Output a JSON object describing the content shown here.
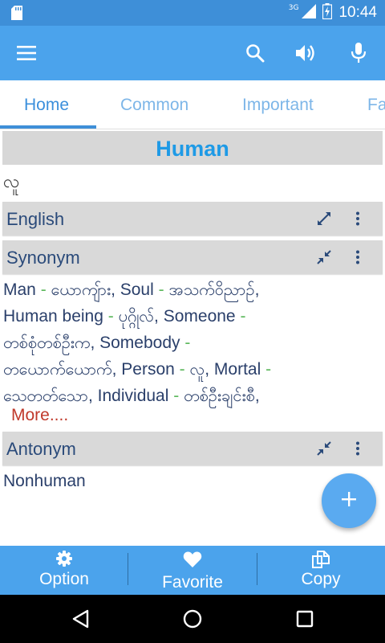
{
  "status_bar": {
    "network_type": "3G",
    "time": "10:44"
  },
  "toolbar": {
    "menu_icon": "hamburger-menu-icon",
    "search_icon": "search-icon",
    "speaker_icon": "speaker-icon",
    "mic_icon": "microphone-icon"
  },
  "tabs": [
    {
      "label": "Home",
      "active": true
    },
    {
      "label": "Common",
      "active": false
    },
    {
      "label": "Important",
      "active": false
    },
    {
      "label": "Fa",
      "active": false
    }
  ],
  "word": {
    "title": "Human",
    "translation": "လူ"
  },
  "sections": {
    "english": {
      "label": "English",
      "icon": "expand-icon"
    },
    "synonym": {
      "label": "Synonym",
      "icon": "collapse-icon"
    },
    "antonym": {
      "label": "Antonym",
      "icon": "collapse-icon"
    }
  },
  "synonyms": [
    {
      "en": "Man",
      "my": "ယောကျ်ား"
    },
    {
      "en": "Soul",
      "my": "အသက်ဝိညာဉ်"
    },
    {
      "en": "Human being",
      "my": "ပုဂ္ဂိုလ်"
    },
    {
      "en": "Someone",
      "my": "တစ်စုံတစ်ဦးက"
    },
    {
      "en": "Somebody",
      "my": "တယောက်ယောက်"
    },
    {
      "en": "Person",
      "my": "လူ"
    },
    {
      "en": "Mortal",
      "my": "သေတတ်သော"
    },
    {
      "en": "Individual",
      "my": "တစ်ဦးချင်းစီ"
    }
  ],
  "more_label": "More....",
  "antonyms": [
    "Nonhuman"
  ],
  "fab_icon": "plus-icon",
  "bottom_bar": [
    {
      "label": "Option",
      "icon": "gear-icon"
    },
    {
      "label": "Favorite",
      "icon": "heart-icon"
    },
    {
      "label": "Copy",
      "icon": "copy-icon"
    }
  ],
  "colors": {
    "primary": "#4ba3ec",
    "status_bar": "#3e8fd8",
    "title_text": "#1e9ae6",
    "separator_green": "#5cb85c",
    "more_red": "#c0392b"
  }
}
